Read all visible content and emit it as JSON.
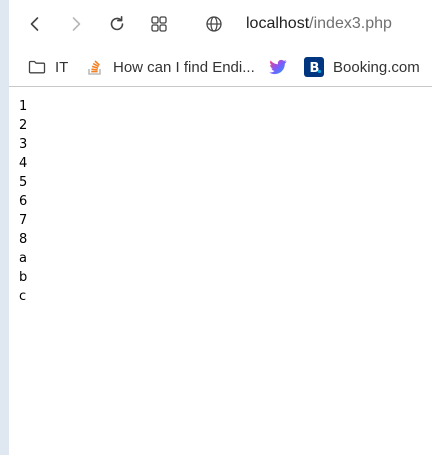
{
  "browser": {
    "url_host": "localhost",
    "url_path": "/index3.php",
    "icons": [
      "back-icon",
      "forward-icon",
      "reload-icon",
      "tab-groups-icon",
      "site-info-icon"
    ]
  },
  "bookmarks": [
    {
      "label": "IT",
      "icon": "folder-icon"
    },
    {
      "label": "How can I find Endi...",
      "icon": "stackoverflow-icon"
    },
    {
      "label": "",
      "icon": "twitter-icon"
    },
    {
      "label": "Booking.com",
      "icon": "booking-icon"
    }
  ],
  "page": {
    "lines": [
      "1",
      "2",
      "3",
      "4",
      "5",
      "6",
      "7",
      "8",
      "a",
      "b",
      "c"
    ]
  },
  "colors": {
    "left_strip": "#dfe7f0",
    "booking_brand": "#003580",
    "twitter_brand": "#1da1f2",
    "stackoverflow_brand": "#f48024"
  }
}
